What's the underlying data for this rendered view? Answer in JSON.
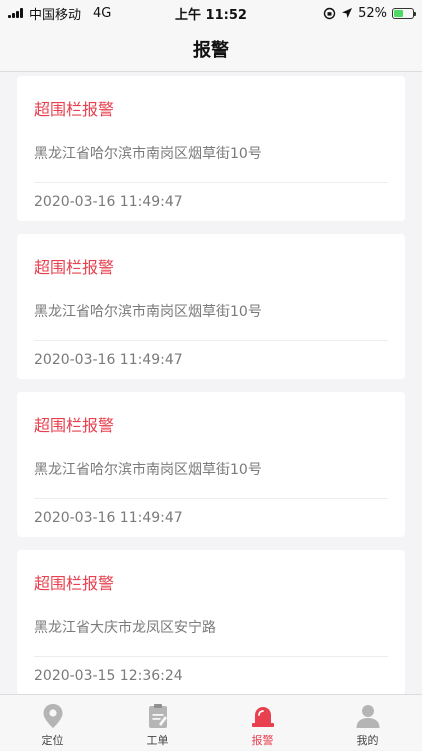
{
  "status_bar": {
    "carrier": "中国移动",
    "network": "4G",
    "time": "上午 11:52",
    "battery_percent": "52%",
    "battery_level": 0.52
  },
  "nav": {
    "title": "报警"
  },
  "alarms": [
    {
      "title": "超围栏报警",
      "address": "黑龙江省哈尔滨市南岗区烟草街10号",
      "time": "2020-03-16 11:49:47"
    },
    {
      "title": "超围栏报警",
      "address": "黑龙江省哈尔滨市南岗区烟草街10号",
      "time": "2020-03-16 11:49:47"
    },
    {
      "title": "超围栏报警",
      "address": "黑龙江省哈尔滨市南岗区烟草街10号",
      "time": "2020-03-16 11:49:47"
    },
    {
      "title": "超围栏报警",
      "address": "黑龙江省大庆市龙凤区安宁路",
      "time": "2020-03-15 12:36:24"
    }
  ],
  "tabs": [
    {
      "label": "定位",
      "icon": "location-pin-icon"
    },
    {
      "label": "工单",
      "icon": "work-order-icon"
    },
    {
      "label": "报警",
      "icon": "alarm-siren-icon",
      "active": true
    },
    {
      "label": "我的",
      "icon": "user-profile-icon"
    }
  ],
  "colors": {
    "accent": "#e8404f",
    "inactive_icon": "#b5b5b5",
    "battery": "#4cd964"
  }
}
